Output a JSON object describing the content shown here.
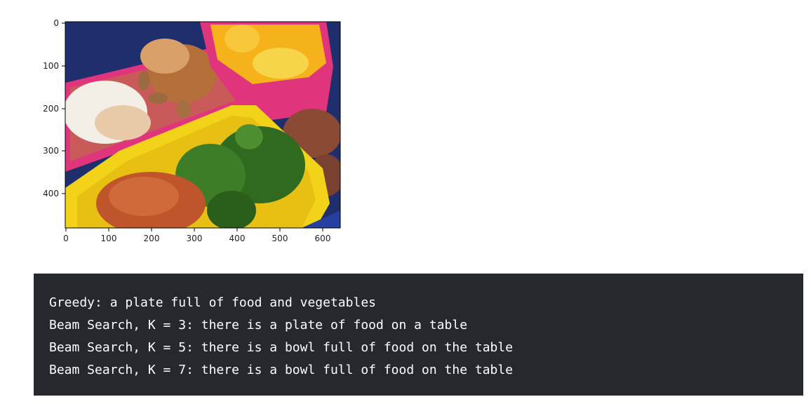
{
  "plot": {
    "x_ticks": [
      "0",
      "100",
      "200",
      "300",
      "400",
      "500",
      "600"
    ],
    "y_ticks": [
      "0",
      "100",
      "200",
      "300",
      "400"
    ],
    "image_description_alt": "",
    "colors": {
      "background_blue": "#1f2f6e",
      "pink_tray": "#e0347d",
      "yellow_tray": "#f3d21a",
      "broccoli": "#2f6a1e",
      "orange_fruit": "#f5b21a",
      "bread": "#f3efe6",
      "muffin": "#c0552b"
    }
  },
  "output": {
    "lines": [
      "Greedy: a plate full of food and vegetables",
      "Beam Search, K = 3: there is a plate of food on a table",
      "Beam Search, K = 5: there is a bowl full of food on the table",
      "Beam Search, K = 7: there is a bowl full of food on the table"
    ],
    "background": "#25282d",
    "text_color": "#ffffff"
  }
}
